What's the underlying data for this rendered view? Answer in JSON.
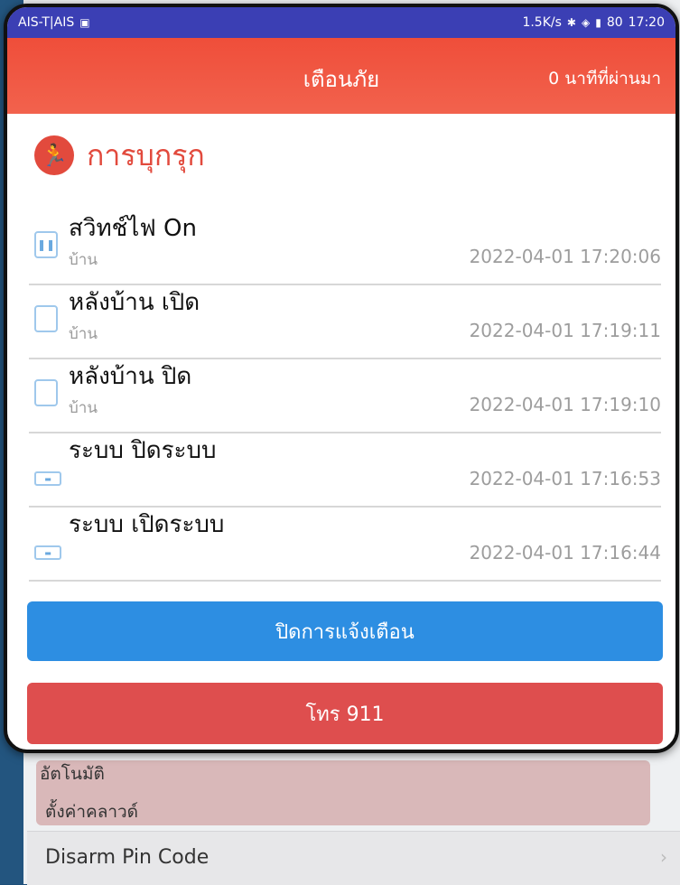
{
  "status_bar": {
    "carrier": "AIS-T|AIS",
    "network_speed": "1.5K/s",
    "battery": "80",
    "time": "17:20"
  },
  "app_bar": {
    "title": "เตือนภัย",
    "elapsed": "0 นาทีที่ผ่านมา"
  },
  "section": {
    "title": "การบุกรุก",
    "icon": "running-person-icon"
  },
  "events": [
    {
      "title": "สวิทช์ไฟ On",
      "location": "บ้าน",
      "timestamp": "2022-04-01 17:20:06",
      "icon": "switch-icon"
    },
    {
      "title": "หลังบ้าน เปิด",
      "location": "บ้าน",
      "timestamp": "2022-04-01 17:19:11",
      "icon": "door-sensor-icon"
    },
    {
      "title": "หลังบ้าน ปิด",
      "location": "บ้าน",
      "timestamp": "2022-04-01 17:19:10",
      "icon": "door-sensor-icon"
    },
    {
      "title": "ระบบ ปิดระบบ",
      "location": "",
      "timestamp": "2022-04-01 17:16:53",
      "icon": "panel-icon"
    },
    {
      "title": "ระบบ เปิดระบบ",
      "location": "",
      "timestamp": "2022-04-01 17:16:44",
      "icon": "panel-icon"
    }
  ],
  "buttons": {
    "dismiss": "ปิดการแจ้งเตือน",
    "call": "โทร 911"
  },
  "background": {
    "auto_label": "อัตโนมัติ",
    "cloud_label": "ตั้งค่าคลาวด์",
    "pin_label": "Disarm Pin Code"
  },
  "colors": {
    "app_bar": "#ef4e3a",
    "accent_red": "#e24a3d",
    "button_blue": "#2d8ee2",
    "button_red": "#de4e4e",
    "status_bar": "#3b3fb4"
  }
}
